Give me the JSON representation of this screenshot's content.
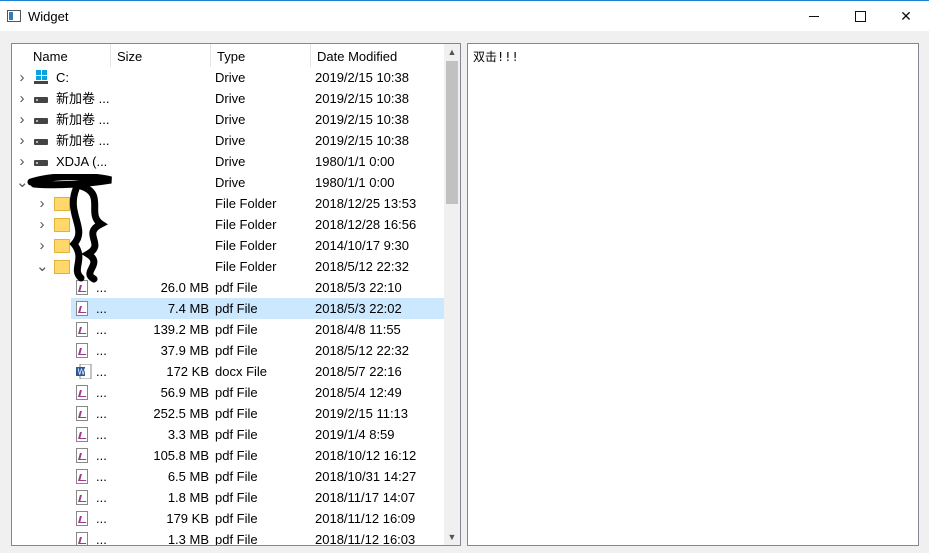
{
  "window": {
    "title": "Widget",
    "icon": "app-window-icon",
    "minimize_icon": "minimize-icon",
    "maximize_icon": "maximize-icon",
    "close_icon": "close-icon"
  },
  "tree": {
    "columns": [
      "Name",
      "Size",
      "Type",
      "Date Modified"
    ],
    "rows": [
      {
        "name": "C:",
        "size": "",
        "type": "Drive",
        "date": "2019/2/15 10:38",
        "icon": "windows-drive-icon",
        "expander": "collapsed",
        "level": 0
      },
      {
        "name": "新加卷 ...",
        "size": "",
        "type": "Drive",
        "date": "2019/2/15 10:38",
        "icon": "drive-icon",
        "expander": "collapsed",
        "level": 0
      },
      {
        "name": "新加卷 ...",
        "size": "",
        "type": "Drive",
        "date": "2019/2/15 10:38",
        "icon": "drive-icon",
        "expander": "collapsed",
        "level": 0
      },
      {
        "name": "新加卷 ...",
        "size": "",
        "type": "Drive",
        "date": "2019/2/15 10:38",
        "icon": "drive-icon",
        "expander": "collapsed",
        "level": 0
      },
      {
        "name": "XDJA (...",
        "size": "",
        "type": "Drive",
        "date": "1980/1/1 0:00",
        "icon": "drive-icon",
        "expander": "collapsed",
        "level": 0
      },
      {
        "name": "",
        "size": "",
        "type": "Drive",
        "date": "1980/1/1 0:00",
        "icon": "drive-icon",
        "expander": "expanded",
        "level": 0
      },
      {
        "name": "",
        "size": "",
        "type": "File Folder",
        "date": "2018/12/25 13:53",
        "icon": "folder-icon",
        "expander": "collapsed",
        "level": 1
      },
      {
        "name": "",
        "size": "",
        "type": "File Folder",
        "date": "2018/12/28 16:56",
        "icon": "folder-icon",
        "expander": "collapsed",
        "level": 1
      },
      {
        "name": "",
        "size": "",
        "type": "File Folder",
        "date": "2014/10/17 9:30",
        "icon": "folder-icon",
        "expander": "collapsed",
        "level": 1
      },
      {
        "name": "",
        "size": "",
        "type": "File Folder",
        "date": "2018/5/12 22:32",
        "icon": "folder-icon",
        "expander": "expanded",
        "level": 1
      },
      {
        "name": "...",
        "size": "26.0 MB",
        "type": "pdf File",
        "date": "2018/5/3 22:10",
        "icon": "pdf-file-icon",
        "expander": "none",
        "level": 2
      },
      {
        "name": "...",
        "size": "7.4 MB",
        "type": "pdf File",
        "date": "2018/5/3 22:02",
        "icon": "pdf-file-icon",
        "expander": "none",
        "level": 2,
        "selected": true
      },
      {
        "name": "...",
        "size": "139.2 MB",
        "type": "pdf File",
        "date": "2018/4/8 11:55",
        "icon": "pdf-file-icon",
        "expander": "none",
        "level": 2
      },
      {
        "name": "...",
        "size": "37.9 MB",
        "type": "pdf File",
        "date": "2018/5/12 22:32",
        "icon": "pdf-file-icon",
        "expander": "none",
        "level": 2
      },
      {
        "name": "...",
        "size": "172 KB",
        "type": "docx File",
        "date": "2018/5/7 22:16",
        "icon": "word-file-icon",
        "expander": "none",
        "level": 2
      },
      {
        "name": "...",
        "size": "56.9 MB",
        "type": "pdf File",
        "date": "2018/5/4 12:49",
        "icon": "pdf-file-icon",
        "expander": "none",
        "level": 2
      },
      {
        "name": "...",
        "size": "252.5 MB",
        "type": "pdf File",
        "date": "2019/2/15 11:13",
        "icon": "pdf-file-icon",
        "expander": "none",
        "level": 2
      },
      {
        "name": "...",
        "size": "3.3 MB",
        "type": "pdf File",
        "date": "2019/1/4 8:59",
        "icon": "pdf-file-icon",
        "expander": "none",
        "level": 2
      },
      {
        "name": "...",
        "size": "105.8 MB",
        "type": "pdf File",
        "date": "2018/10/12 16:12",
        "icon": "pdf-file-icon",
        "expander": "none",
        "level": 2
      },
      {
        "name": "...",
        "size": "6.5 MB",
        "type": "pdf File",
        "date": "2018/10/31 14:27",
        "icon": "pdf-file-icon",
        "expander": "none",
        "level": 2
      },
      {
        "name": "...",
        "size": "1.8 MB",
        "type": "pdf File",
        "date": "2018/11/17 14:07",
        "icon": "pdf-file-icon",
        "expander": "none",
        "level": 2
      },
      {
        "name": "...",
        "size": "179 KB",
        "type": "pdf File",
        "date": "2018/11/12 16:09",
        "icon": "pdf-file-icon",
        "expander": "none",
        "level": 2
      },
      {
        "name": "...",
        "size": "1.3 MB",
        "type": "pdf File",
        "date": "2018/11/12 16:03",
        "icon": "pdf-file-icon",
        "expander": "none",
        "level": 2
      }
    ]
  },
  "text_view": {
    "content": "双击!!!"
  }
}
